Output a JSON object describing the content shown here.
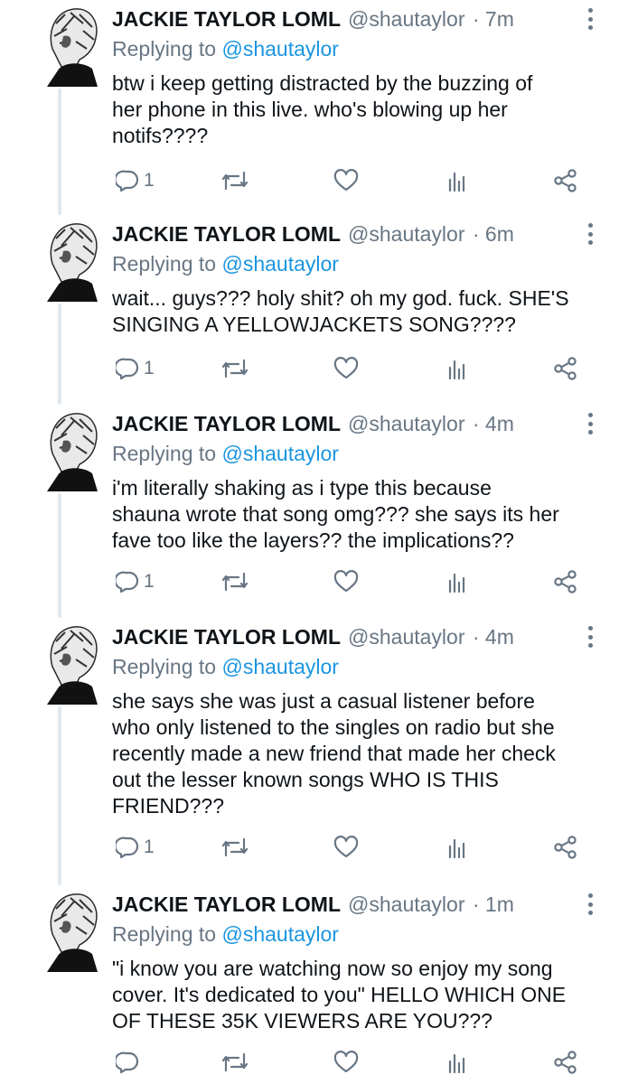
{
  "tweets": [
    {
      "name": "JACKIE TAYLOR LOML",
      "handle": "@shautaylor",
      "time": "· 7m",
      "replying_prefix": "Replying to",
      "replying_to": "@shautaylor",
      "text": "btw i keep getting distracted by the buzzing of\nher phone in this live. who's blowing up her\nnotifs????",
      "reply_count": "1"
    },
    {
      "name": "JACKIE TAYLOR LOML",
      "handle": "@shautaylor",
      "time": "· 6m",
      "replying_prefix": "Replying to",
      "replying_to": "@shautaylor",
      "text": "wait... guys??? holy shit? oh my god. fuck. SHE'S\nSINGING A YELLOWJACKETS SONG????",
      "reply_count": "1"
    },
    {
      "name": "JACKIE TAYLOR LOML",
      "handle": "@shautaylor",
      "time": "· 4m",
      "replying_prefix": "Replying to",
      "replying_to": "@shautaylor",
      "text": "i'm literally shaking as i type this because\nshauna wrote that song omg??? she says its her\nfave too like the layers?? the implications??",
      "reply_count": "1"
    },
    {
      "name": "JACKIE TAYLOR LOML",
      "handle": "@shautaylor",
      "time": "· 4m",
      "replying_prefix": "Replying to",
      "replying_to": "@shautaylor",
      "text": "she says she was just a casual listener before\nwho only listened to the singles on radio but she\nrecently made a new friend that made her check\nout the lesser known songs WHO IS THIS\nFRIEND???",
      "reply_count": "1"
    },
    {
      "name": "JACKIE TAYLOR LOML",
      "handle": "@shautaylor",
      "time": "· 1m",
      "replying_prefix": "Replying to",
      "replying_to": "@shautaylor",
      "text": "\"i know you are watching now so enjoy my song\ncover. It's dedicated to you\" HELLO WHICH ONE\nOF THESE 35K VIEWERS ARE YOU???",
      "reply_count": ""
    }
  ],
  "icons": {
    "reply": "reply-icon",
    "retweet": "retweet-icon",
    "like": "like-icon",
    "analytics": "analytics-icon",
    "share": "share-icon",
    "more": "more-options-icon"
  },
  "colors": {
    "text": "#0f1419",
    "secondary": "#687684",
    "mention": "#1b95e0",
    "thread_line": "#e1e8ed"
  }
}
